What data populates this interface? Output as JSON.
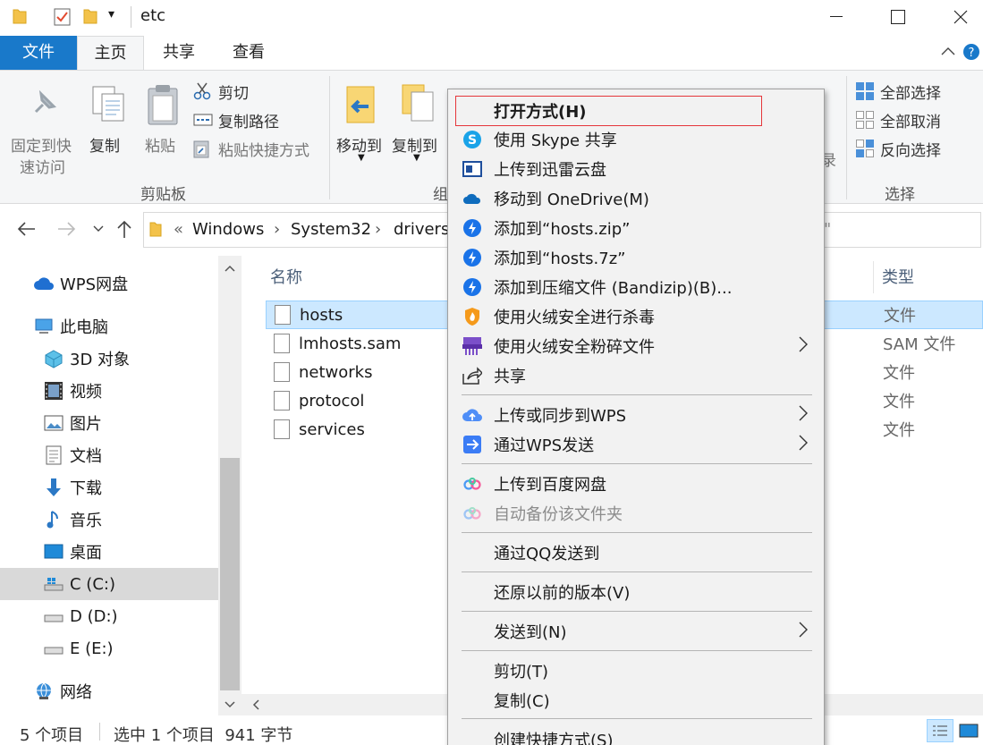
{
  "window": {
    "title": "etc",
    "quick_access_dropdown": "▾",
    "minimize": "—",
    "maximize": "☐",
    "close": "✕"
  },
  "ribbon_tabs": {
    "file": "文件",
    "home": "主页",
    "share": "共享",
    "view": "查看"
  },
  "ribbon": {
    "pin_line1": "固定到快",
    "pin_line2": "速访问",
    "copy": "复制",
    "paste": "粘贴",
    "cut": "剪切",
    "copy_path": "复制路径",
    "paste_shortcut": "粘贴快捷方式",
    "clipboard_group": "剪贴板",
    "move_to": "移动到",
    "copy_to": "复制到",
    "organize_group": "组",
    "select_all": "全部选择",
    "select_none": "全部取消",
    "invert_selection": "反向选择",
    "select_group": "选择"
  },
  "address": {
    "prefix": "«",
    "crumbs": [
      "Windows",
      "System32",
      "drivers"
    ],
    "sep": "›",
    "search_tail": "\""
  },
  "sidebar": {
    "items": [
      {
        "label": "WPS网盘",
        "icon": "cloud-icon"
      },
      {
        "label": "此电脑",
        "icon": "computer-icon"
      },
      {
        "label": "3D 对象",
        "icon": "cube-icon"
      },
      {
        "label": "视频",
        "icon": "film-icon"
      },
      {
        "label": "图片",
        "icon": "picture-icon"
      },
      {
        "label": "文档",
        "icon": "document-icon"
      },
      {
        "label": "下载",
        "icon": "download-icon"
      },
      {
        "label": "音乐",
        "icon": "music-note-icon"
      },
      {
        "label": "桌面",
        "icon": "desktop-icon"
      },
      {
        "label": "C (C:)",
        "icon": "drive-icon"
      },
      {
        "label": "D (D:)",
        "icon": "drive-icon"
      },
      {
        "label": "E (E:)",
        "icon": "drive-icon"
      },
      {
        "label": "网络",
        "icon": "network-icon"
      }
    ],
    "selected": "C (C:)"
  },
  "files": {
    "columns": {
      "name": "名称",
      "type": "类型"
    },
    "rows": [
      {
        "name": "hosts",
        "type": "文件",
        "selected": true
      },
      {
        "name": "lmhosts.sam",
        "type": "SAM 文件"
      },
      {
        "name": "networks",
        "type": "文件"
      },
      {
        "name": "protocol",
        "type": "文件"
      },
      {
        "name": "services",
        "type": "文件"
      }
    ],
    "partial_ribbon_tail": "录"
  },
  "status": {
    "count": "5 个项目",
    "selection": "选中 1 个项目  941 字节"
  },
  "context_menu": {
    "items": [
      {
        "label": "打开方式(H)",
        "icon": "",
        "highlighted": true
      },
      {
        "label": "使用 Skype 共享",
        "icon": "skype-icon"
      },
      {
        "label": "上传到迅雷云盘",
        "icon": "thunder-cloud-icon"
      },
      {
        "label": "移动到 OneDrive(M)",
        "icon": "onedrive-icon"
      },
      {
        "label": "添加到“hosts.zip”",
        "icon": "bandizip-icon"
      },
      {
        "label": "添加到“hosts.7z”",
        "icon": "bandizip-icon"
      },
      {
        "label": "添加到压缩文件 (Bandizip)(B)...",
        "icon": "bandizip-icon"
      },
      {
        "label": "使用火绒安全进行杀毒",
        "icon": "huorong-shield-icon"
      },
      {
        "label": "使用火绒安全粉碎文件",
        "icon": "shredder-icon",
        "submenu": true
      },
      {
        "label": "共享",
        "icon": "share-icon"
      },
      {
        "label": "上传或同步到WPS",
        "icon": "wps-cloud-icon",
        "submenu": true
      },
      {
        "label": "通过WPS发送",
        "icon": "wps-send-icon",
        "submenu": true
      },
      {
        "label": "上传到百度网盘",
        "icon": "baidu-netdisk-icon"
      },
      {
        "label": "自动备份该文件夹",
        "icon": "baidu-netdisk-icon",
        "disabled": true
      },
      {
        "label": "通过QQ发送到",
        "icon": ""
      },
      {
        "label": "还原以前的版本(V)",
        "icon": ""
      },
      {
        "label": "发送到(N)",
        "icon": "",
        "submenu": true
      },
      {
        "label": "剪切(T)",
        "icon": ""
      },
      {
        "label": "复制(C)",
        "icon": ""
      },
      {
        "label": "创建快捷方式(S)",
        "icon": ""
      }
    ]
  },
  "colors": {
    "file_tab": "#1979ca",
    "selection": "#cce8ff",
    "menu_bg": "#f2f2f2",
    "highlight_border": "#e5363a"
  }
}
